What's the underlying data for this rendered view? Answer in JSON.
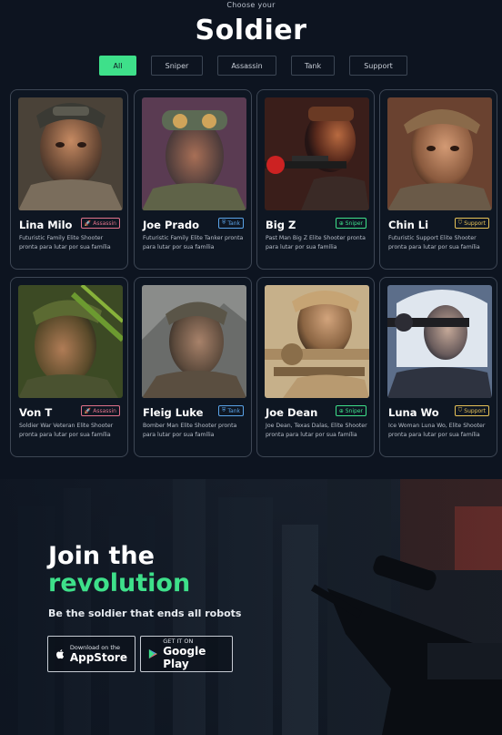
{
  "header": {
    "eyebrow": "Choose your",
    "title": "Soldier"
  },
  "filters": [
    "All",
    "Sniper",
    "Assassin",
    "Tank",
    "Support"
  ],
  "active_filter": "All",
  "colors": {
    "accent": "#3ee08a",
    "assassin": "#e0728a",
    "tank": "#5aa3e8",
    "sniper": "#3ee08a",
    "support": "#e7c257"
  },
  "soldiers": [
    {
      "name": "Lina Milo",
      "role": "Assassin",
      "desc": "Futuristic Family Elite Shooter pronta para lutar por sua família"
    },
    {
      "name": "Joe Prado",
      "role": "Tank",
      "desc": "Futuristic Family Elite Tanker pronta para lutar por sua família"
    },
    {
      "name": "Big Z",
      "role": "Sniper",
      "desc": "Past Man Big Z Elite Shooter pronta para lutar por sua família"
    },
    {
      "name": "Chin Li",
      "role": "Support",
      "desc": "Futuristic Support Elite Shooter pronta para lutar por sua família"
    },
    {
      "name": "Von T",
      "role": "Assassin",
      "desc": "Soldier War Veteran Elite Shooter pronta para lutar por sua família"
    },
    {
      "name": "Fleig Luke",
      "role": "Tank",
      "desc": "Bomber Man Elite Shooter pronta para lutar por sua família"
    },
    {
      "name": "Joe Dean",
      "role": "Sniper",
      "desc": "Joe Dean, Texas Dalas, Elite Shooter pronta para lutar por sua família"
    },
    {
      "name": "Luna Wo",
      "role": "Support",
      "desc": "Ice Woman Luna Wo, Elite Shooter pronta para lutar por sua família"
    }
  ],
  "cta": {
    "title_line1": "Join the",
    "title_line2": "revolution",
    "subtitle": "Be the soldier that ends all robots",
    "appstore_small": "Download on the",
    "appstore_big": "AppStore",
    "googleplay_small": "GET IT ON",
    "googleplay_big": "Google Play"
  }
}
